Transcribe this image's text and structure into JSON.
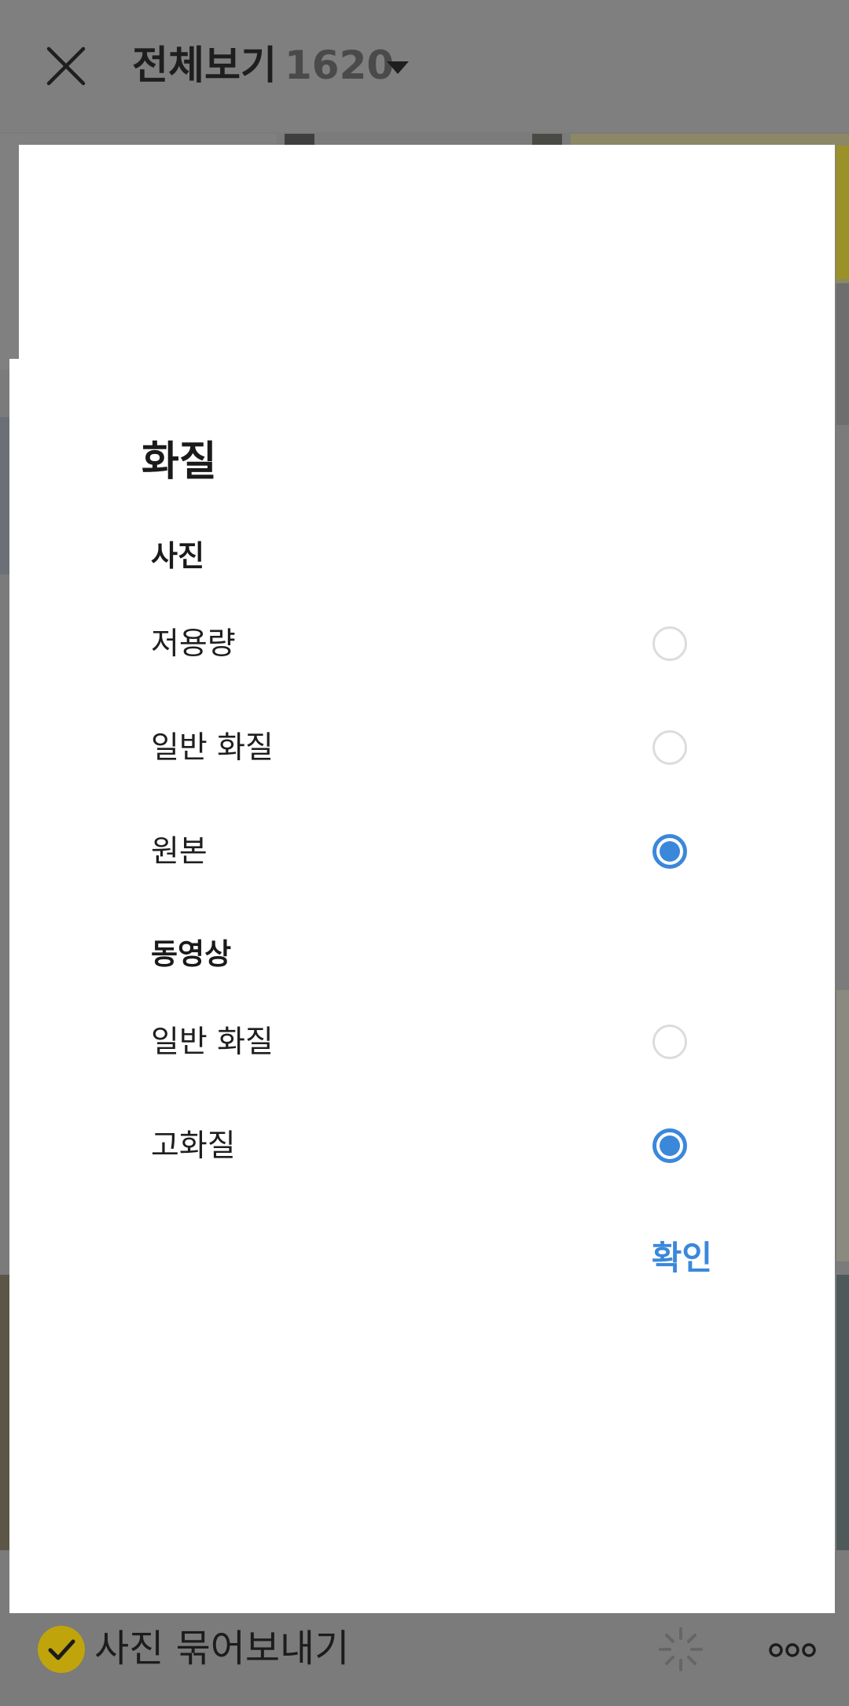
{
  "header": {
    "title": "전체보기",
    "count": "1620",
    "close_icon": "close-icon",
    "dropdown_icon": "caret-down-icon"
  },
  "dialog": {
    "title": "화질",
    "sections": [
      {
        "label": "사진",
        "options": [
          {
            "label": "저용량",
            "selected": false
          },
          {
            "label": "일반 화질",
            "selected": false
          },
          {
            "label": "원본",
            "selected": true
          }
        ]
      },
      {
        "label": "동영상",
        "options": [
          {
            "label": "일반 화질",
            "selected": false
          },
          {
            "label": "고화질",
            "selected": true
          }
        ]
      }
    ],
    "confirm_label": "확인"
  },
  "bottom_bar": {
    "bundle_label": "사진 묶어보내기",
    "bundle_checked": true,
    "loading_icon": "loading-spinner-icon",
    "more_icon": "more-horizontal-icon"
  },
  "colors": {
    "accent": "#3b88da",
    "scrim": "#7b7b7b",
    "check_badge": "#bfa40c"
  }
}
